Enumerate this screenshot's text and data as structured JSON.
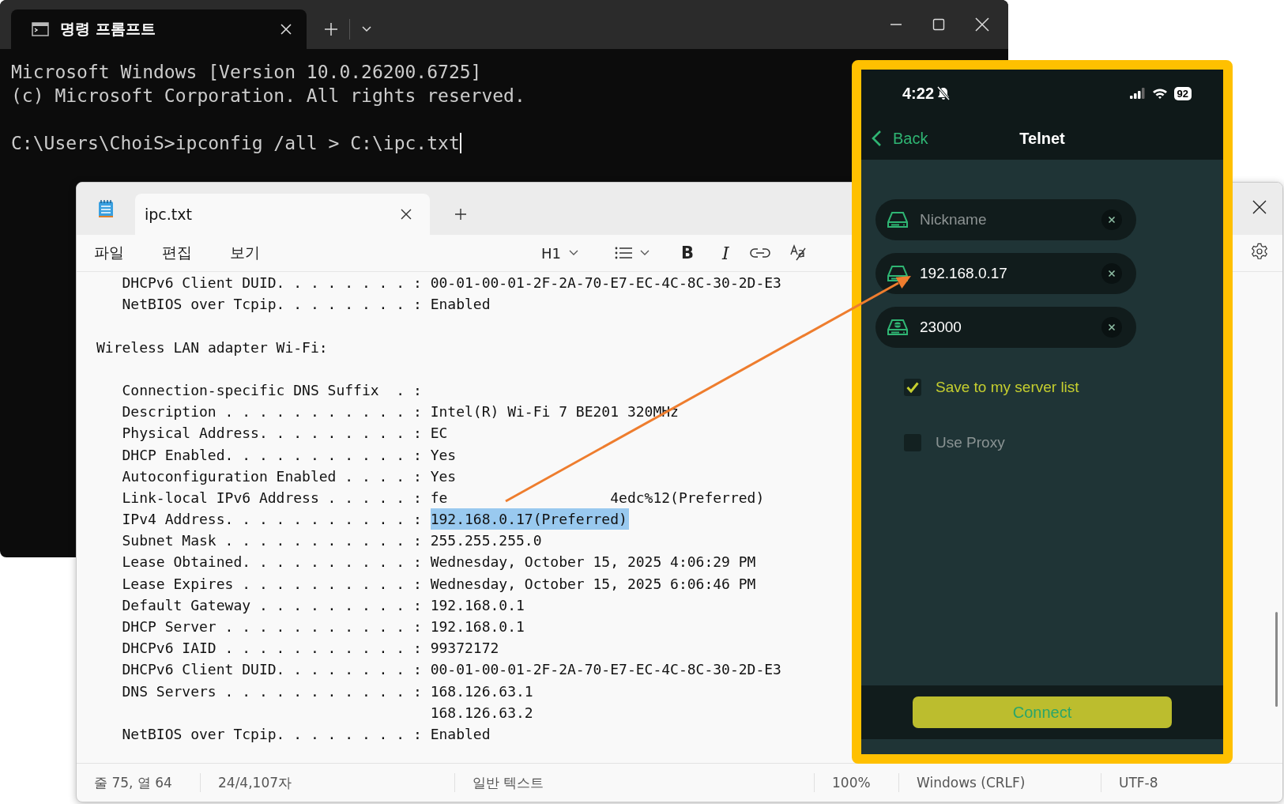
{
  "terminal": {
    "tab_title": "명령 프롬프트",
    "lines": [
      "Microsoft Windows [Version 10.0.26200.6725]",
      "(c) Microsoft Corporation. All rights reserved."
    ],
    "command_line": "C:\\Users\\ChoiS>ipconfig /all > C:\\ipc.txt"
  },
  "notepad": {
    "tab_title": "ipc.txt",
    "menu": [
      "파일",
      "편집",
      "보기"
    ],
    "toolbar": {
      "heading": "H1",
      "bold": "B",
      "italic": "I"
    },
    "lines": [
      {
        "kind": "entry",
        "text": "DHCPv6 Client DUID. . . . . . . . : 00-01-00-01-2F-2A-70-E7-EC-4C-8C-30-2D-E3"
      },
      {
        "kind": "entry",
        "text": "NetBIOS over Tcpip. . . . . . . . : Enabled"
      },
      {
        "kind": "blank"
      },
      {
        "kind": "heading",
        "text": "Wireless LAN adapter Wi-Fi:"
      },
      {
        "kind": "blank"
      },
      {
        "kind": "entry",
        "text": "Connection-specific DNS Suffix  . :"
      },
      {
        "kind": "entry",
        "text": "Description . . . . . . . . . . . : Intel(R) Wi-Fi 7 BE201 320MHz"
      },
      {
        "kind": "entry",
        "text": "Physical Address. . . . . . . . . : EC"
      },
      {
        "kind": "entry",
        "text": "DHCP Enabled. . . . . . . . . . . : Yes"
      },
      {
        "kind": "entry",
        "text": "Autoconfiguration Enabled . . . . : Yes"
      },
      {
        "kind": "entry",
        "text": "Link-local IPv6 Address . . . . . : fe",
        "tail": "4edc%12(Preferred)"
      },
      {
        "kind": "entry",
        "text": "IPv4 Address. . . . . . . . . . . :",
        "selection": "192.168.0.17(Preferred)"
      },
      {
        "kind": "entry",
        "text": "Subnet Mask . . . . . . . . . . . : 255.255.255.0"
      },
      {
        "kind": "entry",
        "text": "Lease Obtained. . . . . . . . . . : Wednesday, October 15, 2025 4:06:29 PM"
      },
      {
        "kind": "entry",
        "text": "Lease Expires . . . . . . . . . . : Wednesday, October 15, 2025 6:06:46 PM"
      },
      {
        "kind": "entry",
        "text": "Default Gateway . . . . . . . . . : 192.168.0.1"
      },
      {
        "kind": "entry",
        "text": "DHCP Server . . . . . . . . . . . : 192.168.0.1"
      },
      {
        "kind": "entry",
        "text": "DHCPv6 IAID . . . . . . . . . . . : 99372172"
      },
      {
        "kind": "entry",
        "text": "DHCPv6 Client DUID. . . . . . . . : 00-01-00-01-2F-2A-70-E7-EC-4C-8C-30-2D-E3"
      },
      {
        "kind": "entry",
        "text": "DNS Servers . . . . . . . . . . . : 168.126.63.1"
      },
      {
        "kind": "continuation",
        "text": "168.126.63.2"
      },
      {
        "kind": "entry",
        "text": "NetBIOS over Tcpip. . . . . . . . : Enabled"
      }
    ],
    "status_bar": [
      "줄 75, 열 64",
      "24/4,107자",
      "일반 텍스트",
      "100%",
      "Windows (CRLF)",
      "UTF-8"
    ]
  },
  "phone": {
    "time": "4:22",
    "battery": "92",
    "nav": {
      "back": "Back",
      "title": "Telnet"
    },
    "fields": [
      {
        "kind": "drive",
        "placeholder": "Nickname"
      },
      {
        "kind": "drive",
        "value": "192.168.0.17"
      },
      {
        "kind": "port",
        "value": "23000"
      }
    ],
    "options": [
      {
        "label": "Save to my server list",
        "checked": true
      },
      {
        "label": "Use Proxy",
        "checked": false
      }
    ],
    "button": "Connect"
  }
}
